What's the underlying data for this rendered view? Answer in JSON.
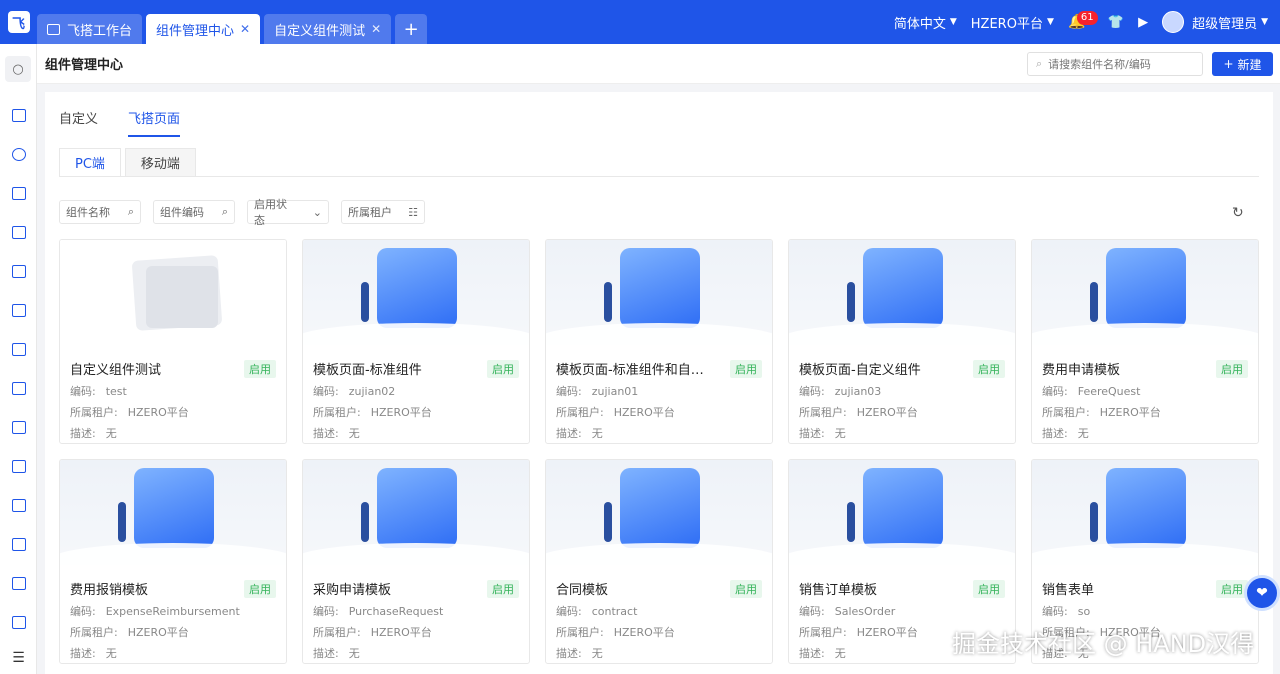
{
  "colors": {
    "brand": "#1f55e8",
    "status_on": "#34b35a"
  },
  "topbar": {
    "tabs": [
      {
        "label": "飞搭工作台",
        "active": false,
        "closable": false
      },
      {
        "label": "组件管理中心",
        "active": true,
        "closable": true
      },
      {
        "label": "自定义组件测试",
        "active": false,
        "closable": true
      }
    ],
    "add_tab": "+",
    "language": "简体中文",
    "platform": "HZERO平台",
    "notifications": "61",
    "user": "超级管理员"
  },
  "header": {
    "title": "组件管理中心",
    "search_placeholder": "请搜索组件名称/编码",
    "new_label": "新建"
  },
  "level_tabs": [
    {
      "label": "自定义",
      "active": false
    },
    {
      "label": "飞搭页面",
      "active": true
    }
  ],
  "sub_tabs": [
    {
      "label": "PC端",
      "active": true
    },
    {
      "label": "移动端",
      "active": false
    }
  ],
  "filters": {
    "name": "组件名称",
    "code": "组件编码",
    "status": "启用状态",
    "tenant": "所属租户"
  },
  "labels": {
    "code": "编码:",
    "tenant": "所属租户:",
    "desc": "描述:"
  },
  "cards": [
    {
      "name": "自定义组件测试",
      "status": "启用",
      "code": "test",
      "tenant": "HZERO平台",
      "desc": "无",
      "icon": "image-placeholder-icon"
    },
    {
      "name": "模板页面-标准组件",
      "status": "启用",
      "code": "zujian02",
      "tenant": "HZERO平台",
      "desc": "无",
      "icon": "calendar-close-icon"
    },
    {
      "name": "模板页面-标准组件和自定义...",
      "status": "启用",
      "code": "zujian01",
      "tenant": "HZERO平台",
      "desc": "无",
      "icon": "clipboard-document-icon"
    },
    {
      "name": "模板页面-自定义组件",
      "status": "启用",
      "code": "zujian03",
      "tenant": "HZERO平台",
      "desc": "无",
      "icon": "mailbox-icon"
    },
    {
      "name": "费用申请模板",
      "status": "启用",
      "code": "FeereQuest",
      "tenant": "HZERO平台",
      "desc": "无",
      "icon": "gear-icon"
    },
    {
      "name": "费用报销模板",
      "status": "启用",
      "code": "ExpenseReimbursement",
      "tenant": "HZERO平台",
      "desc": "无",
      "icon": "lock-icon"
    },
    {
      "name": "采购申请模板",
      "status": "启用",
      "code": "PurchaseRequest",
      "tenant": "HZERO平台",
      "desc": "无",
      "icon": "folder-icon"
    },
    {
      "name": "合同模板",
      "status": "启用",
      "code": "contract",
      "tenant": "HZERO平台",
      "desc": "无",
      "icon": "envelope-check-icon"
    },
    {
      "name": "销售订单模板",
      "status": "启用",
      "code": "SalesOrder",
      "tenant": "HZERO平台",
      "desc": "无",
      "icon": "box-star-icon"
    },
    {
      "name": "销售表单",
      "status": "启用",
      "code": "so",
      "tenant": "HZERO平台",
      "desc": "无",
      "icon": "shopping-cart-icon"
    }
  ],
  "watermark": "掘金技术社区 @ HAND汉得"
}
